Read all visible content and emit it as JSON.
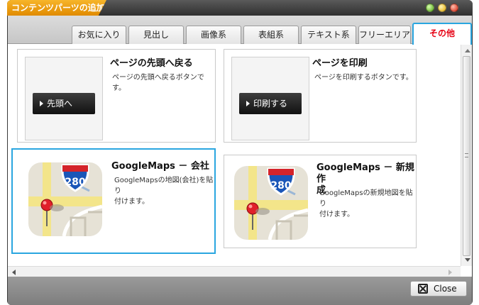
{
  "window": {
    "title": "コンテンツパーツの追加"
  },
  "tabs": [
    {
      "label": "お気に入り"
    },
    {
      "label": "見出し"
    },
    {
      "label": "画像系"
    },
    {
      "label": "表組系"
    },
    {
      "label": "テキスト系"
    },
    {
      "label": "フリーエリア"
    },
    {
      "label": "その他",
      "active": true
    }
  ],
  "cards": [
    {
      "title": "ページの先頭へ戻る",
      "desc": "ページの先頭へ戻るボタンです。",
      "thumb_button": "先頭へ"
    },
    {
      "title": "ページを印刷",
      "desc": "ページを印刷するボタンです。",
      "thumb_button": "印刷する"
    },
    {
      "title": "GoogleMaps － 会社",
      "desc_lines": [
        "GoogleMapsの地図(会社)を貼り",
        "付けます。"
      ],
      "map_sign": "280",
      "selected": true
    },
    {
      "title_lines": [
        "GoogleMaps － 新規作",
        "成"
      ],
      "desc_lines": [
        "GoogleMapsの新規地図を貼り",
        "付けます。"
      ],
      "map_sign": "280"
    }
  ],
  "footer": {
    "close_label": "Close"
  },
  "colors": {
    "accent": "#2aa6e0",
    "active_tab_text": "#e60012",
    "title_tab": "#f0a010"
  }
}
